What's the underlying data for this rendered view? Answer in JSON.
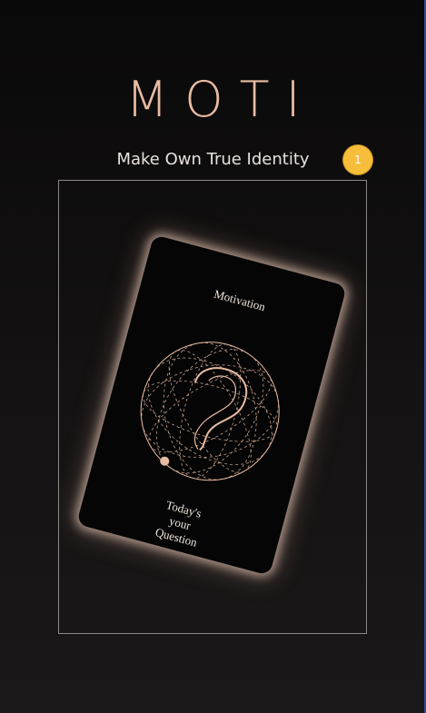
{
  "app": {
    "logo": "MOTI",
    "tagline": "Make Own True Identity",
    "badge_count": "1"
  },
  "card": {
    "title": "Motivation",
    "footer_lines": [
      "Today's",
      "your",
      "Question"
    ],
    "emblem_icon": "question-mark-sphere-icon"
  },
  "colors": {
    "accent": "#e9bca2",
    "badge": "#f6be3a",
    "background": "#0a0909",
    "card": "#050505",
    "frame_border": "#8b8886"
  }
}
